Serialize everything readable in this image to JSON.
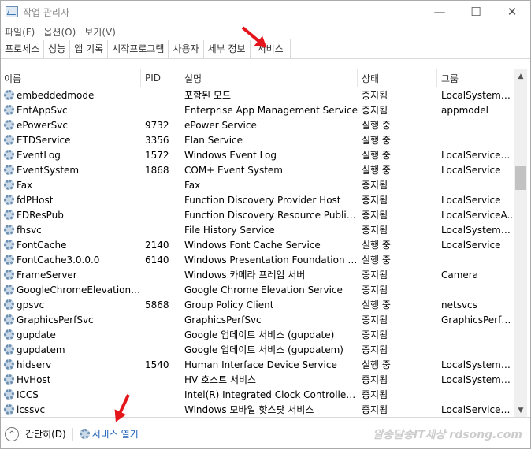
{
  "title": "작업 관리자",
  "menu": [
    "파일(F)",
    "옵션(O)",
    "보기(V)"
  ],
  "tabs": [
    "프로세스",
    "성능",
    "앱 기록",
    "시작프로그램",
    "사용자",
    "세부 정보",
    "서비스"
  ],
  "active_tab": "서비스",
  "columns": [
    "이름",
    "PID",
    "설명",
    "상태",
    "그룹"
  ],
  "rows": [
    [
      "embeddedmode",
      "",
      "포함된 모드",
      "중지됨",
      "LocalSystemN..."
    ],
    [
      "EntAppSvc",
      "",
      "Enterprise App Management Service",
      "중지됨",
      "appmodel"
    ],
    [
      "ePowerSvc",
      "9732",
      "ePower Service",
      "실행 중",
      ""
    ],
    [
      "ETDService",
      "3356",
      "Elan Service",
      "실행 중",
      ""
    ],
    [
      "EventLog",
      "1572",
      "Windows Event Log",
      "실행 중",
      "LocalServiceN..."
    ],
    [
      "EventSystem",
      "1868",
      "COM+ Event System",
      "실행 중",
      "LocalService"
    ],
    [
      "Fax",
      "",
      "Fax",
      "중지됨",
      ""
    ],
    [
      "fdPHost",
      "",
      "Function Discovery Provider Host",
      "중지됨",
      "LocalService"
    ],
    [
      "FDResPub",
      "",
      "Function Discovery Resource Publicat...",
      "중지됨",
      "LocalServiceA..."
    ],
    [
      "fhsvc",
      "",
      "File History Service",
      "중지됨",
      "LocalSystemN..."
    ],
    [
      "FontCache",
      "2140",
      "Windows Font Cache Service",
      "실행 중",
      "LocalService"
    ],
    [
      "FontCache3.0.0.0",
      "6140",
      "Windows Presentation Foundation Fo...",
      "실행 중",
      ""
    ],
    [
      "FrameServer",
      "",
      "Windows 카메라 프레임 서버",
      "중지됨",
      "Camera"
    ],
    [
      "GoogleChromeElevationSe...",
      "",
      "Google Chrome Elevation Service",
      "중지됨",
      ""
    ],
    [
      "gpsvc",
      "5868",
      "Group Policy Client",
      "실행 중",
      "netsvcs"
    ],
    [
      "GraphicsPerfSvc",
      "",
      "GraphicsPerfSvc",
      "중지됨",
      "GraphicsPerfS..."
    ],
    [
      "gupdate",
      "",
      "Google 업데이트 서비스 (gupdate)",
      "중지됨",
      ""
    ],
    [
      "gupdatem",
      "",
      "Google 업데이트 서비스 (gupdatem)",
      "중지됨",
      ""
    ],
    [
      "hidserv",
      "1540",
      "Human Interface Device Service",
      "실행 중",
      "LocalSystemN..."
    ],
    [
      "HvHost",
      "",
      "HV 호스트 서비스",
      "중지됨",
      "LocalSystemN..."
    ],
    [
      "ICCS",
      "",
      "Intel(R) Integrated Clock Controller S...",
      "중지됨",
      ""
    ],
    [
      "icssvc",
      "",
      "Windows 모바일 핫스팟 서비스",
      "중지됨",
      "LocalServiceN..."
    ]
  ],
  "footer": {
    "collapse": "간단히(D)",
    "open_services": "서비스 열기"
  },
  "watermark": "알송달송IT세상 rdsong.com",
  "colors": {
    "link": "#1a5fb4",
    "arrow": "#e4161c"
  }
}
